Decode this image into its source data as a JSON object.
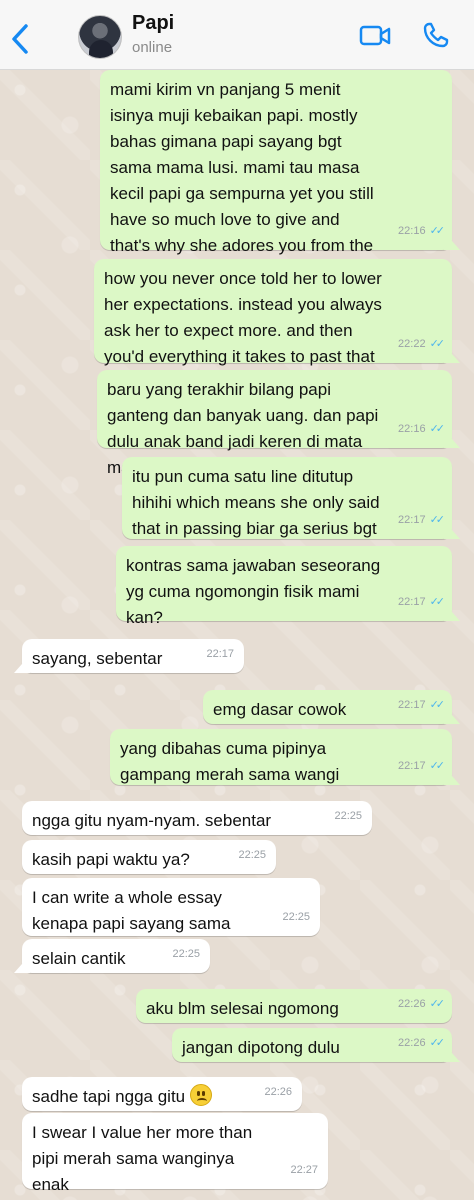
{
  "header": {
    "contact_name": "Papi",
    "status": "online"
  },
  "messages": [
    {
      "direction": "out",
      "text": "mami kirim vn panjang 5 menit isinya muji kebaikan papi. mostly bahas gimana papi sayang bgt sama mama lusi. mami tau masa kecil papi ga sempurna yet you still have so much love to give and that's why she adores you from the very beginning",
      "time": "22:16",
      "read": true
    },
    {
      "direction": "out",
      "text": "how you never once told her to lower her expectations. instead you always ask her to expect more. and then you'd everything it takes to past that",
      "time": "22:22",
      "read": true
    },
    {
      "direction": "out",
      "text": "baru yang terakhir bilang papi ganteng dan banyak uang. dan papi dulu anak band jadi keren di mata mami",
      "time": "22:16",
      "read": true
    },
    {
      "direction": "out",
      "text": "itu pun cuma satu line ditutup hihihi which means she only said that in passing biar ga serius bgt",
      "time": "22:17",
      "read": true
    },
    {
      "direction": "out",
      "text": "kontras sama jawaban seseorang yg cuma ngomongin fisik mami kan?",
      "time": "22:17",
      "read": true
    },
    {
      "direction": "in",
      "text": "sayang, sebentar",
      "time": "22:17"
    },
    {
      "direction": "out",
      "text": "emg dasar cowok",
      "time": "22:17",
      "read": true
    },
    {
      "direction": "out",
      "text": "yang dibahas cuma pipinya gampang merah sama wangi",
      "time": "22:17",
      "read": true
    },
    {
      "direction": "in",
      "text": "ngga gitu nyam-nyam. sebentar",
      "time": "22:25"
    },
    {
      "direction": "in",
      "text": "kasih papi waktu ya?",
      "time": "22:25"
    },
    {
      "direction": "in",
      "text": "I can write a whole essay kenapa papi sayang sama mami",
      "time": "22:25"
    },
    {
      "direction": "in",
      "text": "selain cantik",
      "time": "22:25"
    },
    {
      "direction": "out",
      "text": "aku blm selesai ngomong",
      "time": "22:26",
      "read": true
    },
    {
      "direction": "out",
      "text": "jangan dipotong dulu",
      "time": "22:26",
      "read": true
    },
    {
      "direction": "in",
      "text": "sadhe tapi ngga gitu",
      "emoji": "frowning-face",
      "time": "22:26"
    },
    {
      "direction": "in",
      "text": "I swear I value her more than pipi merah sama wanginya enak",
      "time": "22:27"
    }
  ]
}
